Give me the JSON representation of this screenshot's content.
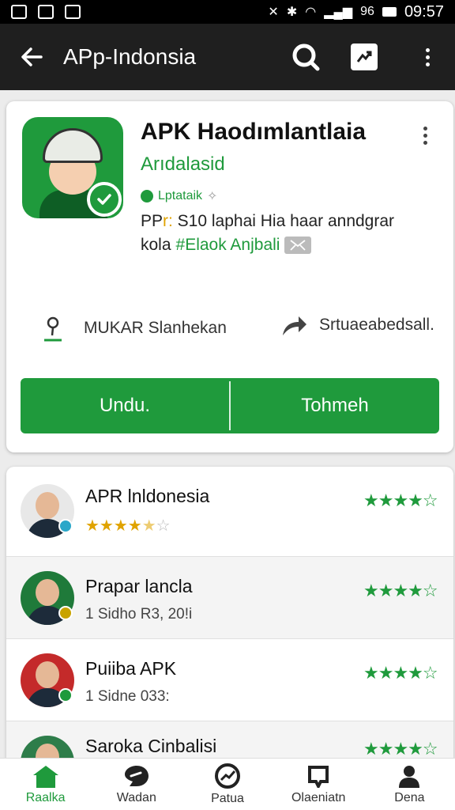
{
  "status_bar": {
    "time": "09:57",
    "signal_text": "96"
  },
  "app_bar": {
    "title": "APp-Indonsia"
  },
  "app_card": {
    "title": "APK Haodımlantlaia",
    "developer": "Arıdalasid",
    "badge": "Lptataik",
    "desc_line1_prefix": "PP",
    "desc_line1_accent": "r:",
    "desc_line1_rest": " S10 laphai Hia haar anndgrar",
    "desc_line2_prefix": "kola",
    "desc_line2_hash": "#Elaok Anjbali",
    "meta_left": "MUKAR Slanhekan",
    "meta_right": "Srtuaeabedsall.",
    "button_left": "Undu.",
    "button_right": "Tohmeh"
  },
  "list": {
    "items": [
      {
        "title": "APR lnldonesia",
        "sub": "",
        "rating_green": 4,
        "rating_gold": 4.5,
        "accent": "#2aa7c9"
      },
      {
        "title": "Prapar lancla",
        "sub": "Sidho R3, 20!i",
        "rating_green": 4,
        "accent": "#c8a300"
      },
      {
        "title": "Puiiba APK",
        "sub": "Sidne 033:",
        "rating_green": 4,
        "accent": "#1f9a3c"
      },
      {
        "title": "Saroka Cinbalisi",
        "sub": "",
        "rating_green": 4,
        "accent": "#1f9a3c"
      }
    ]
  },
  "row_number_1": "1",
  "row_number_2": "1",
  "bottom_nav": {
    "items": [
      {
        "label": "Raalka",
        "icon": "home-icon",
        "active": true
      },
      {
        "label": "Wadan",
        "icon": "tag-icon"
      },
      {
        "label": "Patua",
        "icon": "trending-icon"
      },
      {
        "label": "Olaeniatn",
        "icon": "bookmark-icon"
      },
      {
        "label": "Dena",
        "icon": "person-icon"
      }
    ]
  },
  "colors": {
    "brand_green": "#1f9a3c",
    "appbar": "#1f1f1f",
    "gold": "#e0a300"
  }
}
